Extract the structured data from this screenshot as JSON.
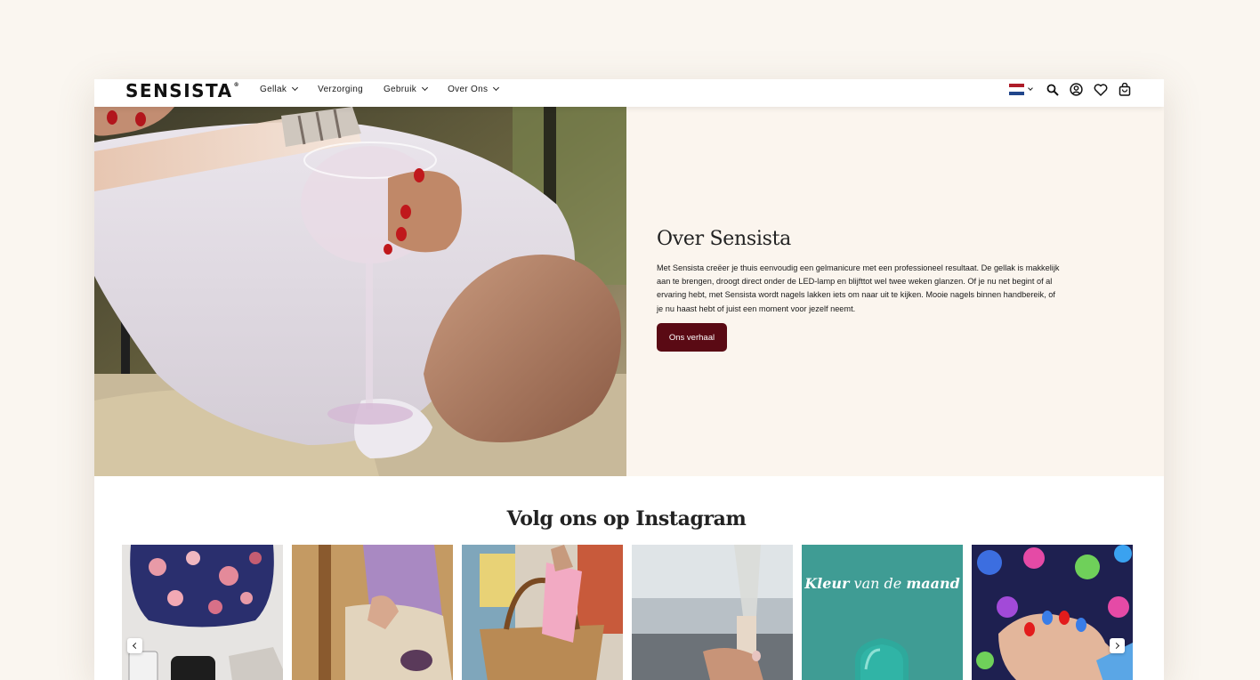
{
  "brand": {
    "logo": "SENSISTA",
    "trademark": "®"
  },
  "nav": {
    "items": [
      {
        "label": "Gellak",
        "dropdown": true
      },
      {
        "label": "Verzorging",
        "dropdown": false
      },
      {
        "label": "Gebruik",
        "dropdown": true
      },
      {
        "label": "Over Ons",
        "dropdown": true
      }
    ]
  },
  "header_icons": [
    "flag-nl-icon",
    "search-icon",
    "account-icon",
    "heart-icon",
    "cart-icon"
  ],
  "hero": {
    "title": "Over Sensista",
    "body": "Met Sensista creëer je thuis eenvoudig een gelmanicure met een professioneel resultaat. De gellak is makkelijk aan te brengen, droogt direct onder de LED-lamp en blijfttot wel twee weken glanzen. Of je nu net begint of al ervaring hebt, met Sensista wordt nagels lakken iets om naar uit te kijken. Mooie nagels binnen handbereik, of je nu haast hebt of juist een moment voor jezelf neemt.",
    "button": "Ons verhaal"
  },
  "instagram": {
    "title": "Volg ons op Instagram",
    "tile5_text": {
      "part1": "Kleur",
      "part2": "van de",
      "part3": "maand"
    }
  },
  "colors": {
    "accent": "#5a0a14",
    "page_bg": "#faf6f0",
    "hero_text_bg": "#fbf5ee"
  }
}
